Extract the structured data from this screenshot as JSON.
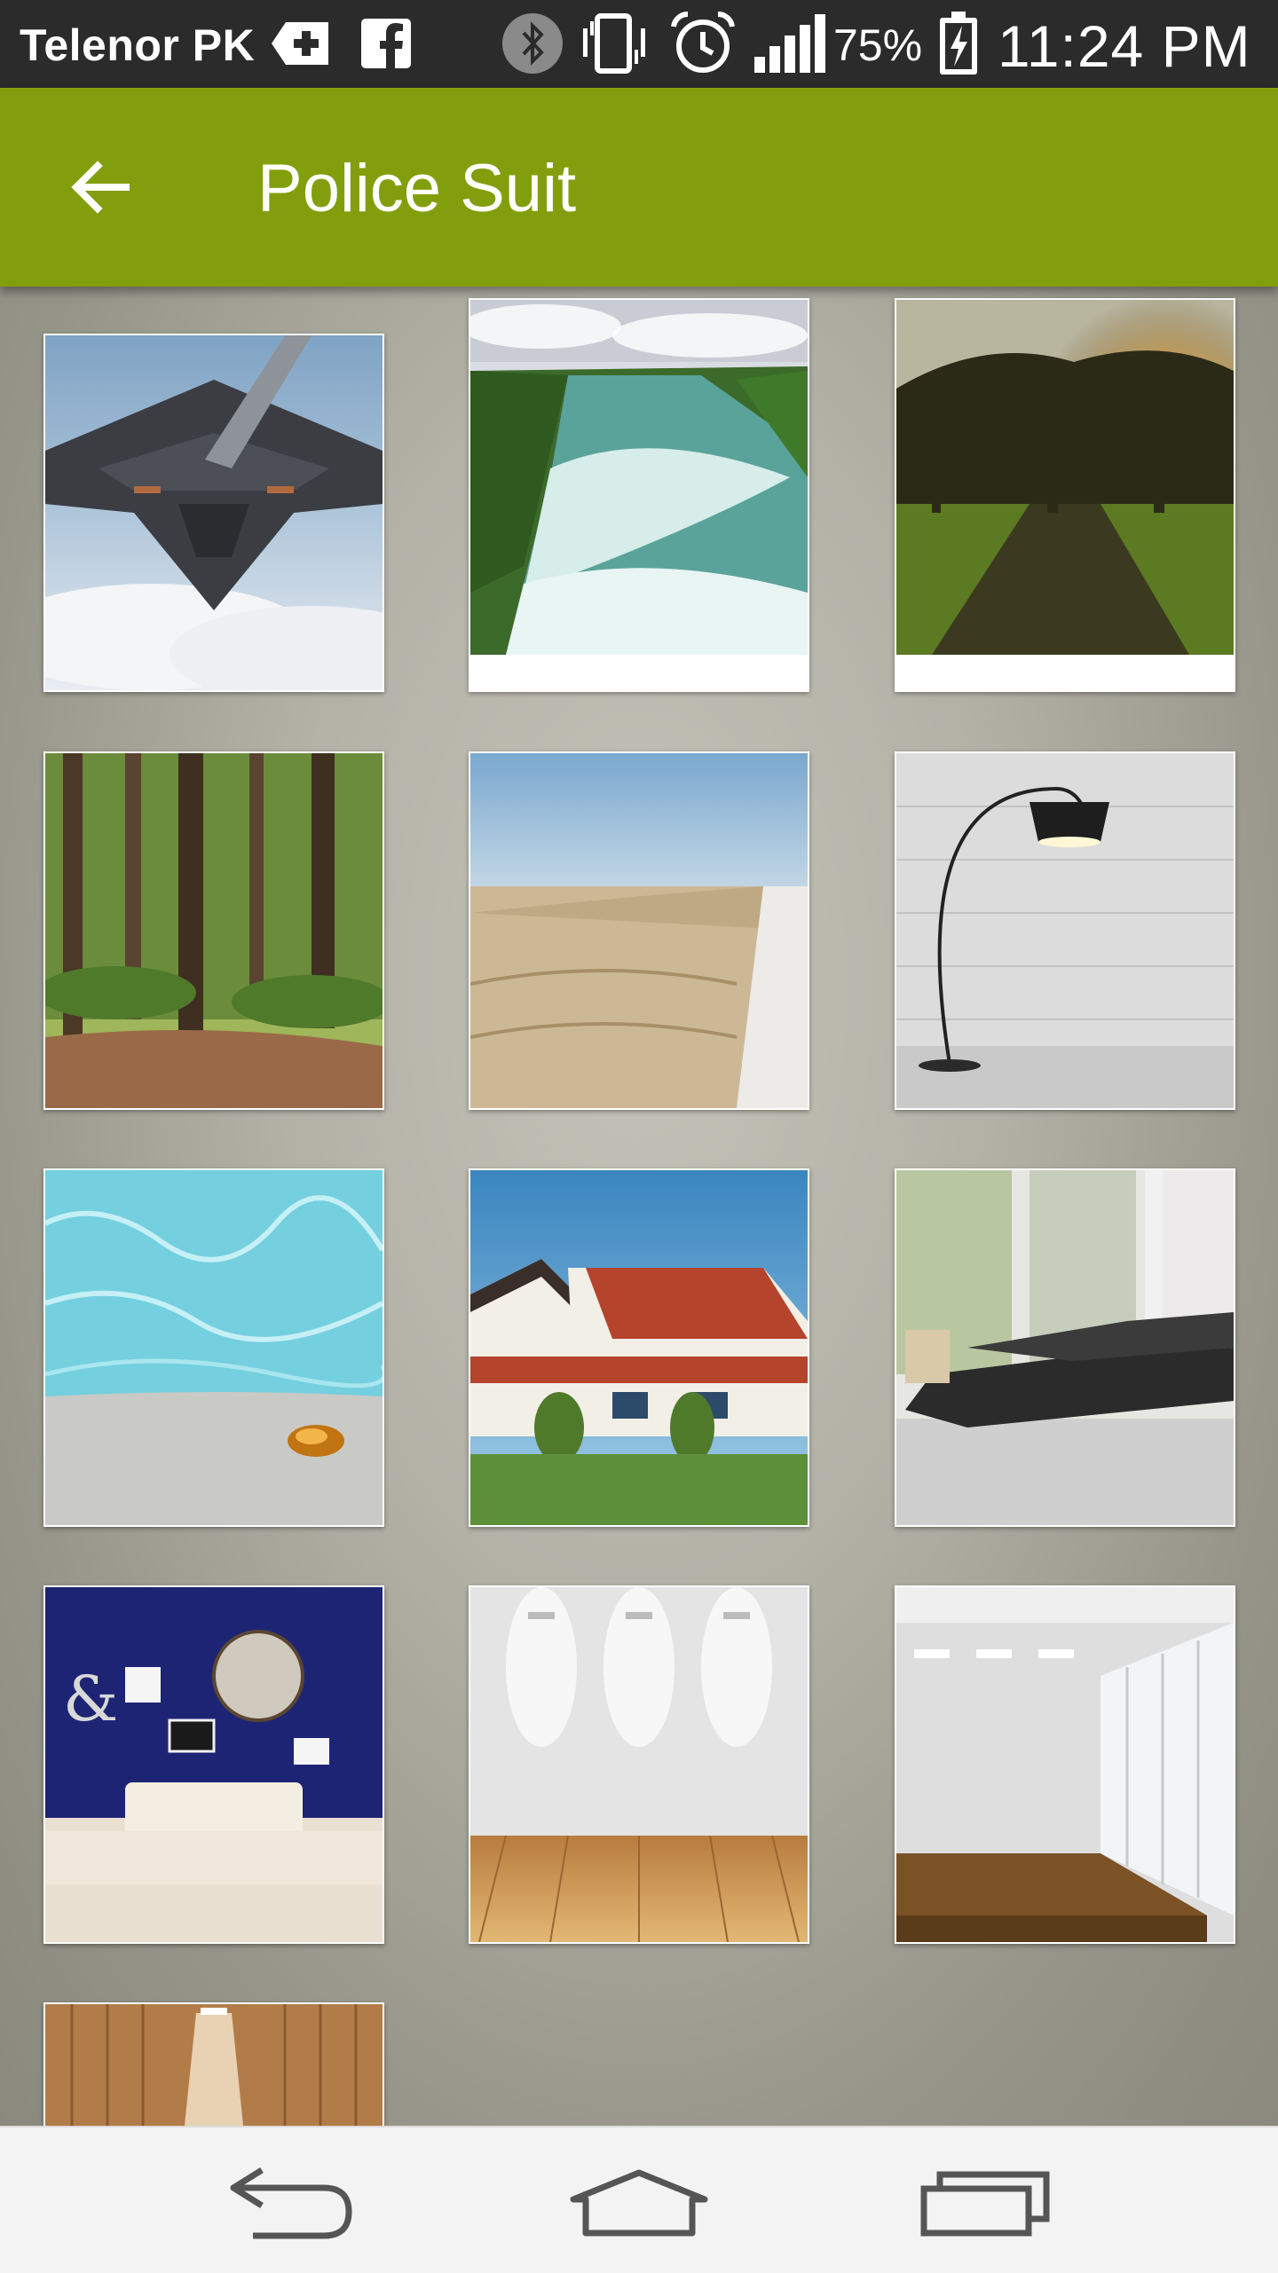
{
  "status_bar": {
    "carrier": "Telenor PK",
    "battery": "75%",
    "time": "11:24 PM",
    "icons": [
      "add-notification-icon",
      "facebook-icon",
      "bluetooth-icon",
      "vibrate-icon",
      "alarm-icon",
      "signal-icon",
      "battery-charging-icon"
    ]
  },
  "app_bar": {
    "title": "Police Suit",
    "back_icon": "arrow-back-icon",
    "color": "#839e0c"
  },
  "gallery": {
    "items": [
      {
        "name": "stealth-bomber"
      },
      {
        "name": "river-rapids"
      },
      {
        "name": "sunset-tree-road"
      },
      {
        "name": "forest-path"
      },
      {
        "name": "wheat-field"
      },
      {
        "name": "arc-lamp-brick-wall"
      },
      {
        "name": "pool-water-beach"
      },
      {
        "name": "tudor-house"
      },
      {
        "name": "black-sofa-room"
      },
      {
        "name": "blue-wall-white-sofa"
      },
      {
        "name": "spotlight-wood-floor"
      },
      {
        "name": "empty-room-windows"
      },
      {
        "name": "wooden-room-spotlight"
      }
    ]
  },
  "nav_bar": {
    "buttons": [
      "back-nav-icon",
      "home-icon",
      "recent-apps-icon"
    ]
  }
}
